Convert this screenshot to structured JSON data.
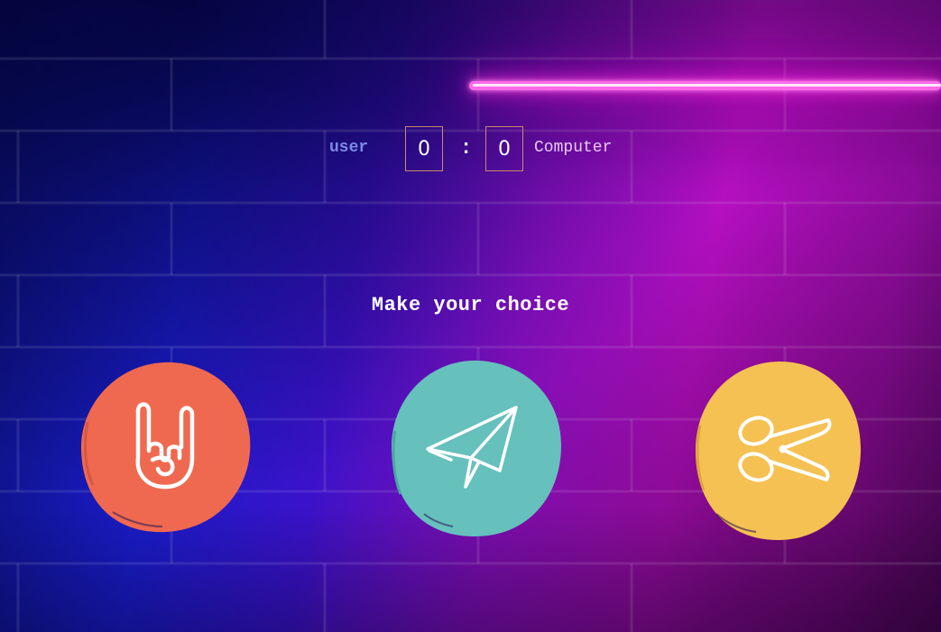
{
  "scoreboard": {
    "user_label": "user",
    "user_score": "0",
    "separator": ":",
    "computer_score": "0",
    "computer_label": "Computer"
  },
  "prompt": "Make your choice",
  "choices": [
    {
      "id": "rock",
      "icon": "rock-hand-icon",
      "color": "#ef6950"
    },
    {
      "id": "paper",
      "icon": "paper-plane-icon",
      "color": "#66c0bc"
    },
    {
      "id": "scissors",
      "icon": "scissors-icon",
      "color": "#f5c152"
    }
  ],
  "colors": {
    "neon": "#ff4ae6",
    "score_border": "#c98a6a",
    "user_label": "#7e8ae6"
  }
}
